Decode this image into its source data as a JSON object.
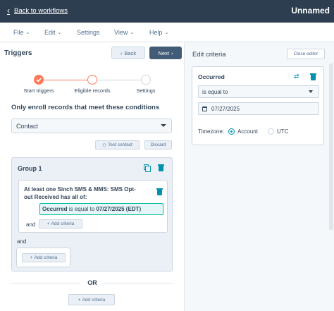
{
  "topbar": {
    "back_label": "Back to workflows",
    "workflow_name": "Unnamed"
  },
  "menu": {
    "items": [
      "File",
      "Edit",
      "Settings",
      "View",
      "Help"
    ]
  },
  "triggers": {
    "title": "Triggers",
    "back_label": "Back",
    "next_label": "Next",
    "steps": [
      "Start triggers",
      "Eligible records",
      "Settings"
    ],
    "enroll_title": "Only enroll records that meet these conditions",
    "object_select": "Contact",
    "test_contact_label": "Test contact",
    "discard_label": "Discard",
    "group": {
      "title": "Group 1",
      "condition_text": "At least one Sinch SMS & MMS: SMS Opt-out Received has all of:",
      "criterion_property": "Occurred",
      "criterion_operator": "is equal to",
      "criterion_value": "07/27/2025 (EDT)",
      "and_label": "and",
      "add_criteria_label": "Add criteria",
      "and_outer_label": "and",
      "add_criteria_outer_label": "Add criteria"
    },
    "or_label": "OR",
    "add_criteria_bottom_label": "Add criteria"
  },
  "editor": {
    "title": "Edit criteria",
    "close_label": "Close editor",
    "property": "Occurred",
    "operator": "is equal to",
    "date_value": "07/27/2025",
    "timezone_label": "Timezone:",
    "timezone_options": [
      "Account",
      "UTC"
    ],
    "timezone_selected": "Account"
  },
  "colors": {
    "topbar": "#2d3e50",
    "accent": "#ff7a59",
    "teal": "#0091ae",
    "next_button": "#425b76"
  }
}
